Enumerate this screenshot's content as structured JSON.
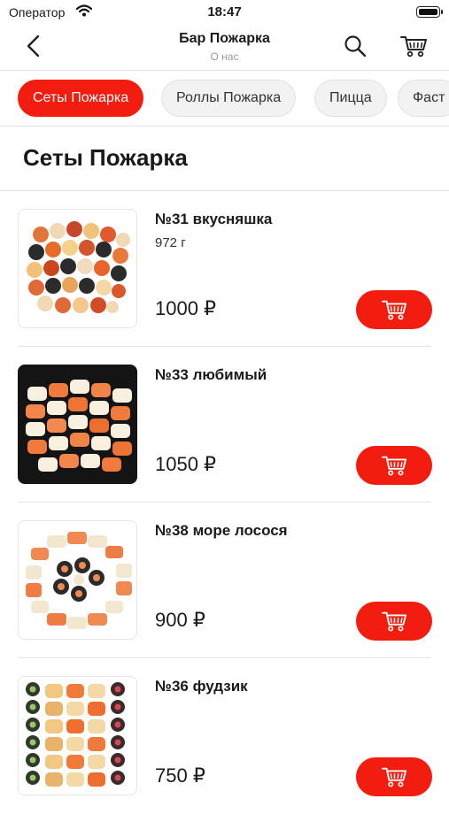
{
  "status_bar": {
    "carrier": "Оператор",
    "time": "18:47"
  },
  "navbar": {
    "title": "Бар Пожарка",
    "subtitle": "О нас"
  },
  "categories": [
    {
      "label": "Сеты Пожарка",
      "active": true
    },
    {
      "label": "Роллы Пожарка",
      "active": false
    },
    {
      "label": "Пицца",
      "active": false
    },
    {
      "label": "Фаст",
      "active": false
    }
  ],
  "section": {
    "title": "Сеты Пожарка"
  },
  "products": [
    {
      "name": "№31 вкусняшка",
      "weight": "972 г",
      "price": "1000 ₽"
    },
    {
      "name": "№33 любимый",
      "weight": "",
      "price": "1050 ₽"
    },
    {
      "name": "№38 море лосося",
      "weight": "",
      "price": "900 ₽"
    },
    {
      "name": "№36 фудзик",
      "weight": "",
      "price": "750 ₽"
    }
  ],
  "colors": {
    "accent": "#f21c0f",
    "chip_bg": "#f2f2f2",
    "divider": "#e3e3e3"
  },
  "icons": [
    "back-arrow-icon",
    "search-icon",
    "cart-icon",
    "wifi-icon",
    "battery-icon"
  ]
}
